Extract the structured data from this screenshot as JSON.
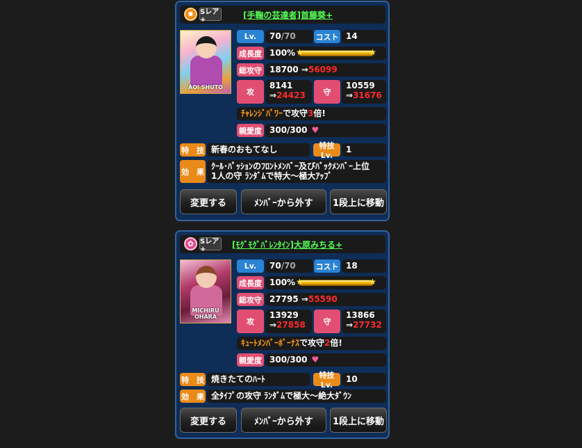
{
  "cards": [
    {
      "rarity_badge": "Sレア+",
      "rarity_icon": "sun-icon",
      "name": "[手鞠の芸達者]首藤葵+",
      "thumb_text": "AOI SHUTO",
      "level_label": "Lv.",
      "level_current": "70",
      "level_max": "/70",
      "cost_label": "コスト",
      "cost_value": "14",
      "growth_label": "成長度",
      "growth_value": "100%",
      "growth_fraction": 1.0,
      "total_label": "総攻守",
      "total_base": "18700 ⇒",
      "total_boost": "56099",
      "atk_label": "攻",
      "atk_base": "8141",
      "atk_boost": "24423",
      "def_label": "守",
      "def_base": "10559",
      "def_boost": "31676",
      "bonus_pre": "ﾁｬﾚﾝｼﾞﾊﾟﾜｰ",
      "bonus_mid": "で攻守",
      "bonus_mult": "3",
      "bonus_post": "倍!",
      "affection_label": "親愛度",
      "affection_value": "300/300",
      "skill_label": "特　技",
      "skill_name": "新春のおもてなし",
      "skill_lv_label": "特技Lv.",
      "skill_lv": "1",
      "effect_label": "効　果",
      "effect_line1": "ｸｰﾙ･ﾊﾟｯｼｮﾝのﾌﾛﾝﾄﾒﾝﾊﾞｰ及びﾊﾞｯｸﾒﾝﾊﾞｰ上位",
      "effect_line2": "1人の守 ﾗﾝﾀﾞﾑで特大〜極大ｱｯﾌﾟ",
      "btn_change": "変更する",
      "btn_remove": "ﾒﾝﾊﾞｰから外す",
      "btn_move": "1段上に移動"
    },
    {
      "rarity_badge": "Sレア+",
      "rarity_icon": "flower-icon",
      "name": "[ﾓｸﾞﾓｸﾞﾊﾞﾚﾝﾀｲﾝ]大原みちる+",
      "thumb_text": "MICHIRU OHARA",
      "level_label": "Lv.",
      "level_current": "70",
      "level_max": "/70",
      "cost_label": "コスト",
      "cost_value": "18",
      "growth_label": "成長度",
      "growth_value": "100%",
      "growth_fraction": 1.0,
      "total_label": "総攻守",
      "total_base": "27795 ⇒",
      "total_boost": "55590",
      "atk_label": "攻",
      "atk_base": "13929",
      "atk_boost": "27858",
      "def_label": "守",
      "def_base": "13866",
      "def_boost": "27732",
      "bonus_pre": "ｷｭｰﾄﾒﾝﾊﾞｰﾎﾞｰﾅｽ",
      "bonus_mid": "で攻守",
      "bonus_mult": "2",
      "bonus_post": "倍!",
      "affection_label": "親愛度",
      "affection_value": "300/300",
      "skill_label": "特　技",
      "skill_name": "焼きたてのﾊｰﾄ",
      "skill_lv_label": "特技Lv.",
      "skill_lv": "10",
      "effect_label": "効　果",
      "effect_line1": "全ﾀｲﾌﾟの攻守 ﾗﾝﾀﾞﾑで極大〜絶大ﾀﾞｳﾝ",
      "effect_line2": "",
      "btn_change": "変更する",
      "btn_remove": "ﾒﾝﾊﾞｰから外す",
      "btn_move": "1段上に移動"
    }
  ]
}
